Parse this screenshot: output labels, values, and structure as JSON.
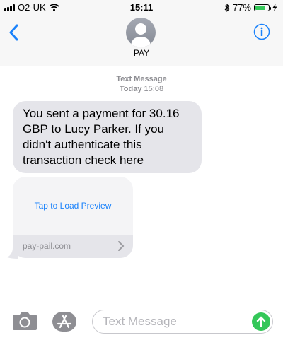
{
  "status_bar": {
    "carrier": "O2-UK",
    "time": "15:11",
    "battery_percent": "77%",
    "battery_level": 0.77
  },
  "header": {
    "contact_name": "PAY"
  },
  "thread": {
    "meta_title": "Text Message",
    "meta_day": "Today",
    "meta_time": "15:08",
    "message_text": "You sent a payment for 30.16 GBP to Lucy Parker. If you didn't authenticate this transaction check here",
    "link_preview": {
      "load_label": "Tap to Load Preview",
      "domain": "pay-pail.com"
    }
  },
  "input_bar": {
    "placeholder": "Text Message"
  },
  "colors": {
    "accent": "#1a82fb",
    "bubble": "#e5e5ea",
    "send": "#34c759"
  }
}
